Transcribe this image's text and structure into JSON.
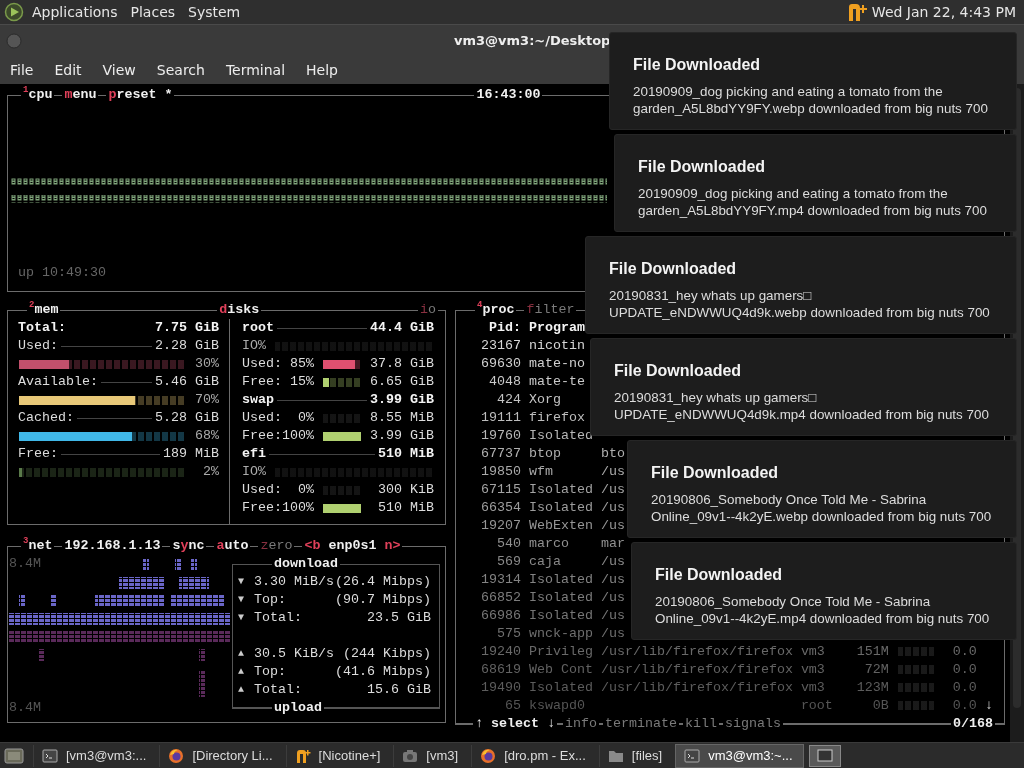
{
  "top_panel": {
    "menus": [
      "Applications",
      "Places",
      "System"
    ],
    "clock": "Wed Jan 22, 4:43 PM"
  },
  "window": {
    "title": "vm3@vm3:~/Desktop",
    "menus": [
      "File",
      "Edit",
      "View",
      "Search",
      "Terminal",
      "Help"
    ]
  },
  "cpu": {
    "tabs": [
      {
        "label": "$^{1}$cpu",
        "on": true
      },
      {
        "label": "**m**enu",
        "on": true
      },
      {
        "label": "**p**reset *",
        "on": true
      }
    ],
    "clock": "16:43:00",
    "uptime": "up 10:49:30"
  },
  "mem": {
    "tab": {
      "label": "$^{2}$mem",
      "on": true
    },
    "rows": [
      {
        "kind": "total",
        "label": "Total:",
        "value": "7.75 GiB"
      },
      {
        "kind": "stat",
        "label": "Used:",
        "value": "2.28 GiB"
      },
      {
        "kind": "meter",
        "level": 0.3,
        "color": "#c2506c",
        "reading": "30%"
      },
      {
        "kind": "stat",
        "label": "Available:",
        "value": "5.46 GiB"
      },
      {
        "kind": "meter",
        "level": 0.7,
        "color": "#e8c878",
        "reading": "70%"
      },
      {
        "kind": "stat",
        "label": "Cached:",
        "value": "5.28 GiB"
      },
      {
        "kind": "meter",
        "level": 0.68,
        "color": "#40b8e8",
        "reading": "68%"
      },
      {
        "kind": "stat",
        "label": "Free:",
        "value": "189 MiB"
      },
      {
        "kind": "meter",
        "level": 0.02,
        "color": "#5a7a4a",
        "reading": "2%"
      }
    ]
  },
  "disks": {
    "tabs": [
      {
        "label": "**d**isks",
        "on": true
      },
      {
        "label": "**i**o",
        "on": false
      }
    ],
    "rows": [
      {
        "kind": "disk",
        "label": "root",
        "value": "44.4 GiB"
      },
      {
        "kind": "io",
        "label": "IO%"
      },
      {
        "kind": "usage",
        "label": "Used: 85%",
        "level": 0.85,
        "color": "#e05070",
        "value": "37.8 GiB"
      },
      {
        "kind": "usage",
        "label": "Free: 15%",
        "level": 0.15,
        "color": "#b0d070",
        "value": "6.65 GiB"
      },
      {
        "kind": "disk",
        "label": "swap",
        "value": "3.99 GiB"
      },
      {
        "kind": "usage",
        "label": "Used:  0%",
        "value": "8.55 MiB"
      },
      {
        "kind": "usage",
        "label": "Free:100%",
        "level": 1,
        "color": "#b0d070",
        "value": "3.99 GiB"
      },
      {
        "kind": "disk",
        "label": "efi",
        "value": "510 MiB"
      },
      {
        "kind": "io",
        "label": "IO%"
      },
      {
        "kind": "usage",
        "label": "Used:  0%",
        "value": "300 KiB"
      },
      {
        "kind": "usage",
        "label": "Free:100%",
        "level": 1,
        "color": "#b0d070",
        "value": "510 MiB"
      }
    ]
  },
  "net": {
    "tabs": [
      {
        "label": "$^{3}$net",
        "on": true
      },
      {
        "label": "192.168.1.13",
        "on": true
      },
      {
        "label": "s**y**nc",
        "on": true
      },
      {
        "label": "**a**uto",
        "on": true
      },
      {
        "label": "**z**ero",
        "on": false
      },
      {
        "label": "**<b** enp0s1 **n>**",
        "on": true
      }
    ],
    "scale_top": "8.4M",
    "scale_bottom": "8.4M",
    "download": {
      "title": "download",
      "rows": [
        {
          "arrow": "▼",
          "label": "3.30 MiB/s",
          "value": "(26.4 Mibps)"
        },
        {
          "arrow": "▼",
          "label": "Top:",
          "value": "(90.7 Mibps)"
        },
        {
          "arrow": "▼",
          "label": "Total:",
          "value": "23.5 GiB"
        }
      ]
    },
    "upload": {
      "title": "upload",
      "rows": [
        {
          "arrow": "▲",
          "label": "30.5 KiB/s",
          "value": "(244 Kibps)"
        },
        {
          "arrow": "▲",
          "label": "Top:",
          "value": "(41.6 Mibps)"
        },
        {
          "arrow": "▲",
          "label": "Total:",
          "value": "15.6 GiB"
        }
      ]
    }
  },
  "proc": {
    "tabs": [
      {
        "label": "$^{4}$proc",
        "on": true
      },
      {
        "label": "**f**ilter",
        "on": false
      }
    ],
    "columns": [
      "Pid:",
      "Program"
    ],
    "rows": [
      {
        "pid": "23167",
        "program": "nicotin"
      },
      {
        "pid": "69630",
        "program": "mate-no"
      },
      {
        "pid": "4048",
        "program": "mate-te"
      },
      {
        "pid": "424",
        "program": "Xorg"
      },
      {
        "pid": "19111",
        "program": "firefox"
      },
      {
        "pid": "19760",
        "program": "Isolated"
      },
      {
        "pid": "67737",
        "program": "btop",
        "command": "bto"
      },
      {
        "pid": "19850",
        "program": "wfm",
        "command": "/us"
      },
      {
        "pid": "67115",
        "program": "Isolated",
        "command": "/us"
      },
      {
        "pid": "66354",
        "program": "Isolated",
        "command": "/us"
      },
      {
        "pid": "19207",
        "program": "WebExten",
        "command": "/us"
      },
      {
        "pid": "540",
        "program": "marco",
        "command": "mar"
      },
      {
        "pid": "569",
        "program": "caja",
        "command": "/us"
      },
      {
        "pid": "19314",
        "program": "Isolated",
        "command": "/us"
      },
      {
        "pid": "66852",
        "program": "Isolated",
        "command": "/us"
      },
      {
        "pid": "66986",
        "program": "Isolated",
        "command": "/us"
      },
      {
        "pid": "575",
        "program": "wnck-app",
        "command": "/us"
      },
      {
        "pid": "19240",
        "program": "Privileg",
        "command": "/usr/lib/firefox/firefox",
        "user": "vm3",
        "mem": "151M",
        "cpu": "0.0"
      },
      {
        "pid": "68619",
        "program": "Web Cont",
        "command": "/usr/lib/firefox/firefox",
        "user": "vm3",
        "mem": "72M",
        "cpu": "0.0"
      },
      {
        "pid": "19490",
        "program": "Isolated",
        "command": "/usr/lib/firefox/firefox",
        "user": "vm3",
        "mem": "123M",
        "cpu": "0.0"
      },
      {
        "pid": "65",
        "program": "kswapd0",
        "user": "root",
        "mem": "0B",
        "cpu": "0.0",
        "scroll": "↓"
      }
    ],
    "footer": [
      {
        "label": "*↑* select *↓*",
        "on": true
      },
      {
        "label": "info",
        "on": false
      },
      {
        "label": "terminate",
        "on": false
      },
      {
        "label": "kill",
        "on": false
      },
      {
        "label": "signals",
        "on": false
      }
    ],
    "count": "0/168"
  },
  "notifications": [
    {
      "title": "File Downloaded",
      "body": "20190909_dog picking and eating a tomato from the garden_A5L8bdYY9FY.webp downloaded from big nuts 700"
    },
    {
      "title": "File Downloaded",
      "body": "20190909_dog picking and eating a tomato from the garden_A5L8bdYY9FY.mp4 downloaded from big nuts 700"
    },
    {
      "title": "File Downloaded",
      "body": "20190831_hey whats up gamers□ UPDATE_eNDWWUQ4d9k.webp downloaded from big nuts 700"
    },
    {
      "title": "File Downloaded",
      "body": "20190831_hey whats up gamers□ UPDATE_eNDWWUQ4d9k.mp4 downloaded from big nuts 700"
    },
    {
      "title": "File Downloaded",
      "body": "20190806_Somebody Once Told Me - Sabrina Online_09v1--4k2yE.webp downloaded from big nuts 700"
    },
    {
      "title": "File Downloaded",
      "body": "20190806_Somebody Once Told Me - Sabrina Online_09v1--4k2yE.mp4 downloaded from big nuts 700"
    }
  ],
  "taskbar": [
    {
      "label": "[vm3@vm3:...",
      "kind": "terminal",
      "selected": false
    },
    {
      "label": "[Directory Li...",
      "kind": "browser",
      "selected": false
    },
    {
      "label": "[Nicotine+]",
      "kind": "nicotine",
      "selected": false
    },
    {
      "label": "[vm3]",
      "kind": "camera",
      "selected": false
    },
    {
      "label": "[dro.pm - Ex...",
      "kind": "browser",
      "selected": false
    },
    {
      "label": "[files]",
      "kind": "folder",
      "selected": false
    },
    {
      "label": "vm3@vm3:~...",
      "kind": "terminal",
      "selected": true
    }
  ]
}
